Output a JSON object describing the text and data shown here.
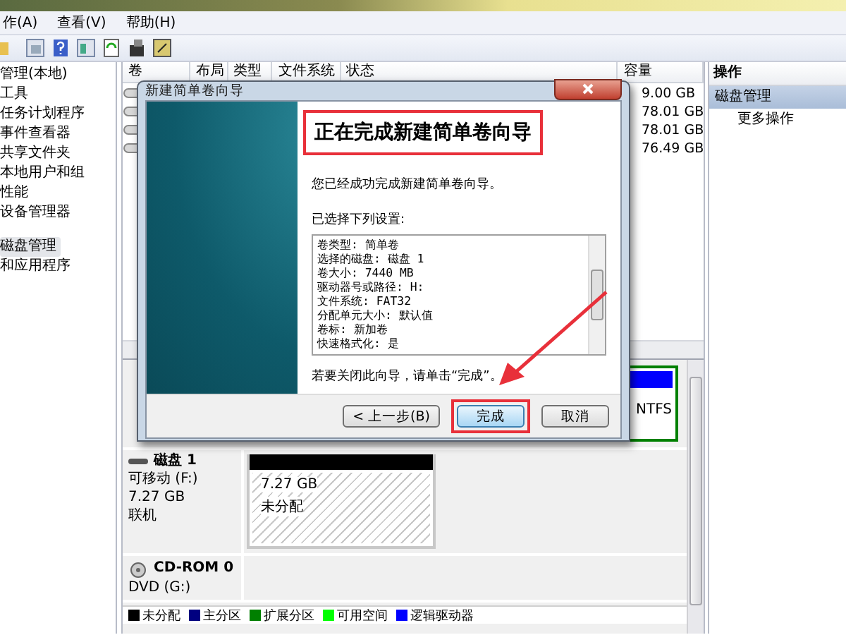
{
  "menu": [
    {
      "label": "作(A)"
    },
    {
      "label": "查看(V)"
    },
    {
      "label": "帮助(H)"
    }
  ],
  "tree": [
    {
      "label": "管理(本地)",
      "selected": false
    },
    {
      "label": "工具",
      "selected": false
    },
    {
      "label": "任务计划程序",
      "selected": false
    },
    {
      "label": "事件查看器",
      "selected": false
    },
    {
      "label": "共享文件夹",
      "selected": false
    },
    {
      "label": "本地用户和组",
      "selected": false
    },
    {
      "label": "性能",
      "selected": false
    },
    {
      "label": "设备管理器",
      "selected": false
    },
    {
      "label": "磁盘管理",
      "selected": true
    },
    {
      "label": "和应用程序",
      "selected": false
    }
  ],
  "volume_table": {
    "columns": [
      "卷",
      "布局",
      "类型",
      "文件系统",
      "状态",
      "容量"
    ],
    "rows": [
      {
        "capacity": "9.00 GB"
      },
      {
        "capacity": "78.01 GB"
      },
      {
        "capacity": "78.01 GB"
      },
      {
        "capacity": "76.49 GB"
      }
    ]
  },
  "actions": {
    "title": "操作",
    "items": [
      {
        "label": "磁盘管理",
        "selected": true
      },
      {
        "label": "更多操作",
        "selected": false
      }
    ]
  },
  "disk0": {
    "partition_text": "NTFS"
  },
  "disks": [
    {
      "name": "磁盘 1",
      "kind": "removable",
      "lines": [
        "可移动 (F:)",
        "7.27 GB",
        "联机"
      ],
      "partitions": [
        {
          "size": "7.27 GB",
          "status": "未分配",
          "kind": "unallocated"
        }
      ]
    },
    {
      "name": "CD-ROM 0",
      "kind": "cdrom",
      "lines": [
        "DVD (G:)"
      ]
    }
  ],
  "legend": [
    {
      "label": "未分配",
      "color": "#000000"
    },
    {
      "label": "主分区",
      "color": "#000080"
    },
    {
      "label": "扩展分区",
      "color": "#008000"
    },
    {
      "label": "可用空间",
      "color": "#00ff00"
    },
    {
      "label": "逻辑驱动器",
      "color": "#0000ff"
    }
  ],
  "dialog": {
    "title": "新建简单卷向导",
    "heading": "正在完成新建简单卷向导",
    "intro": "您已经成功完成新建简单卷向导。",
    "settings_label": "已选择下列设置:",
    "settings": [
      "卷类型: 简单卷",
      "选择的磁盘: 磁盘 1",
      "卷大小: 7440 MB",
      "驱动器号或路径: H:",
      "文件系统: FAT32",
      "分配单元大小: 默认值",
      "卷标: 新加卷",
      "快速格式化: 是"
    ],
    "closing": "若要关闭此向导，请单击“完成”。",
    "buttons": [
      {
        "label": "< 上一步(B)",
        "kind": "back"
      },
      {
        "label": "完成",
        "kind": "default"
      },
      {
        "label": "取消",
        "kind": "cancel"
      }
    ]
  }
}
